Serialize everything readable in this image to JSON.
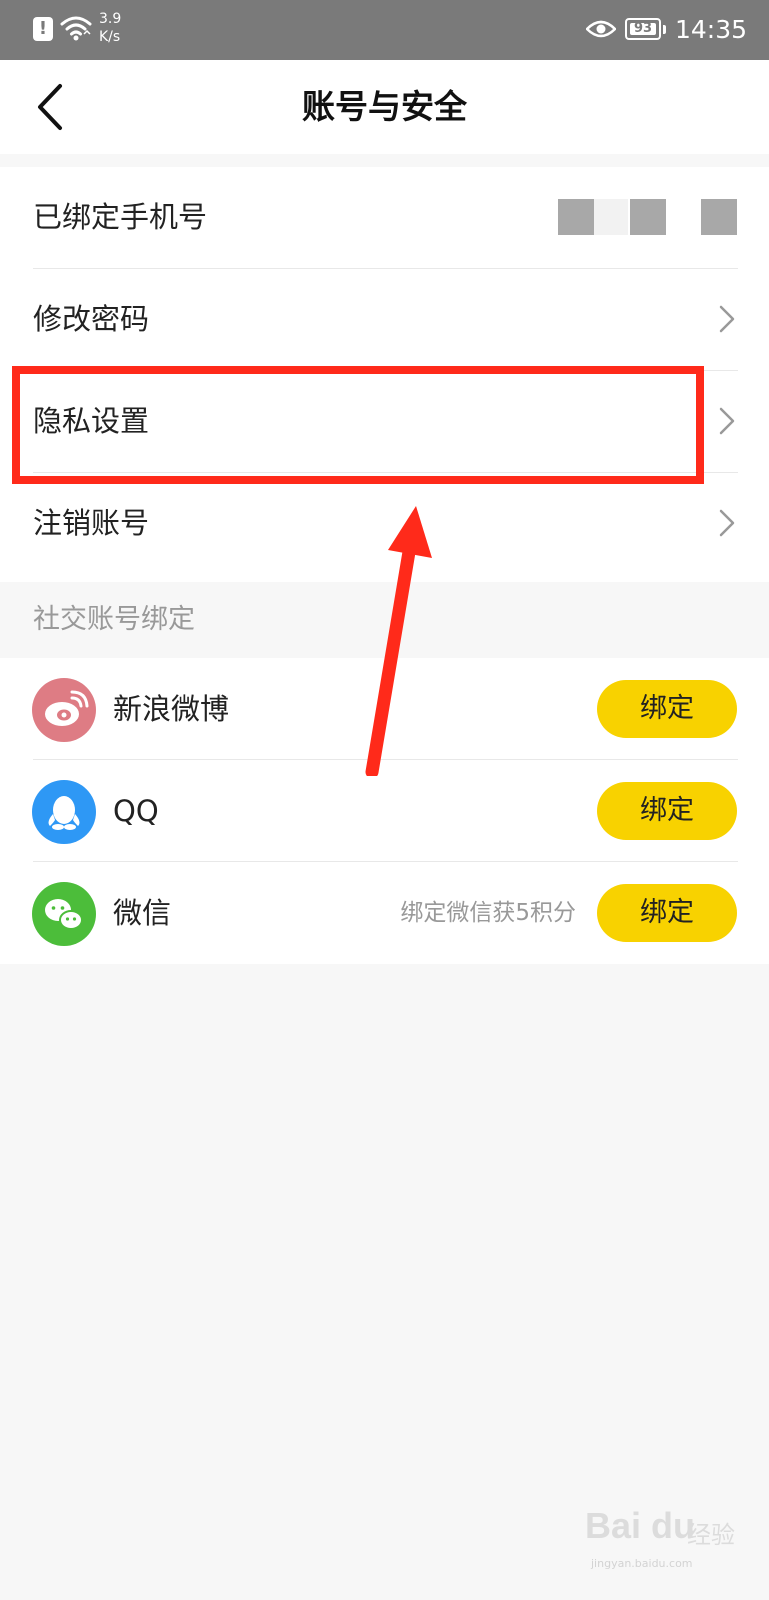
{
  "status_bar": {
    "alert_icon": "!",
    "net_speed_value": "3.9",
    "net_speed_unit": "K/s",
    "battery_level": "93",
    "time": "14:35",
    "icons": [
      "alert-icon",
      "wifi-icon",
      "eye-icon",
      "battery-icon"
    ]
  },
  "header": {
    "title": "账号与安全",
    "back_icon": "chevron-left-icon"
  },
  "account": {
    "phone_label": "已绑定手机号",
    "change_password_label": "修改密码",
    "privacy_label": "隐私设置",
    "delete_account_label": "注销账号"
  },
  "social": {
    "section_title": "社交账号绑定",
    "items": [
      {
        "name": "新浪微博",
        "hint": "",
        "button_label": "绑定",
        "icon": "weibo-icon",
        "color": "#de7c84"
      },
      {
        "name": "QQ",
        "hint": "",
        "button_label": "绑定",
        "icon": "qq-icon",
        "color": "#2e98f5"
      },
      {
        "name": "微信",
        "hint": "绑定微信获5积分",
        "button_label": "绑定",
        "icon": "wechat-icon",
        "color": "#4cbd3a"
      }
    ]
  },
  "colors": {
    "accent_yellow": "#f8d200",
    "annotation_red": "#ff2a1a",
    "status_bar": "#7a7a7a"
  },
  "watermark": {
    "logo": "Bai du",
    "text": "经验",
    "url": "jingyan.baidu.com"
  }
}
